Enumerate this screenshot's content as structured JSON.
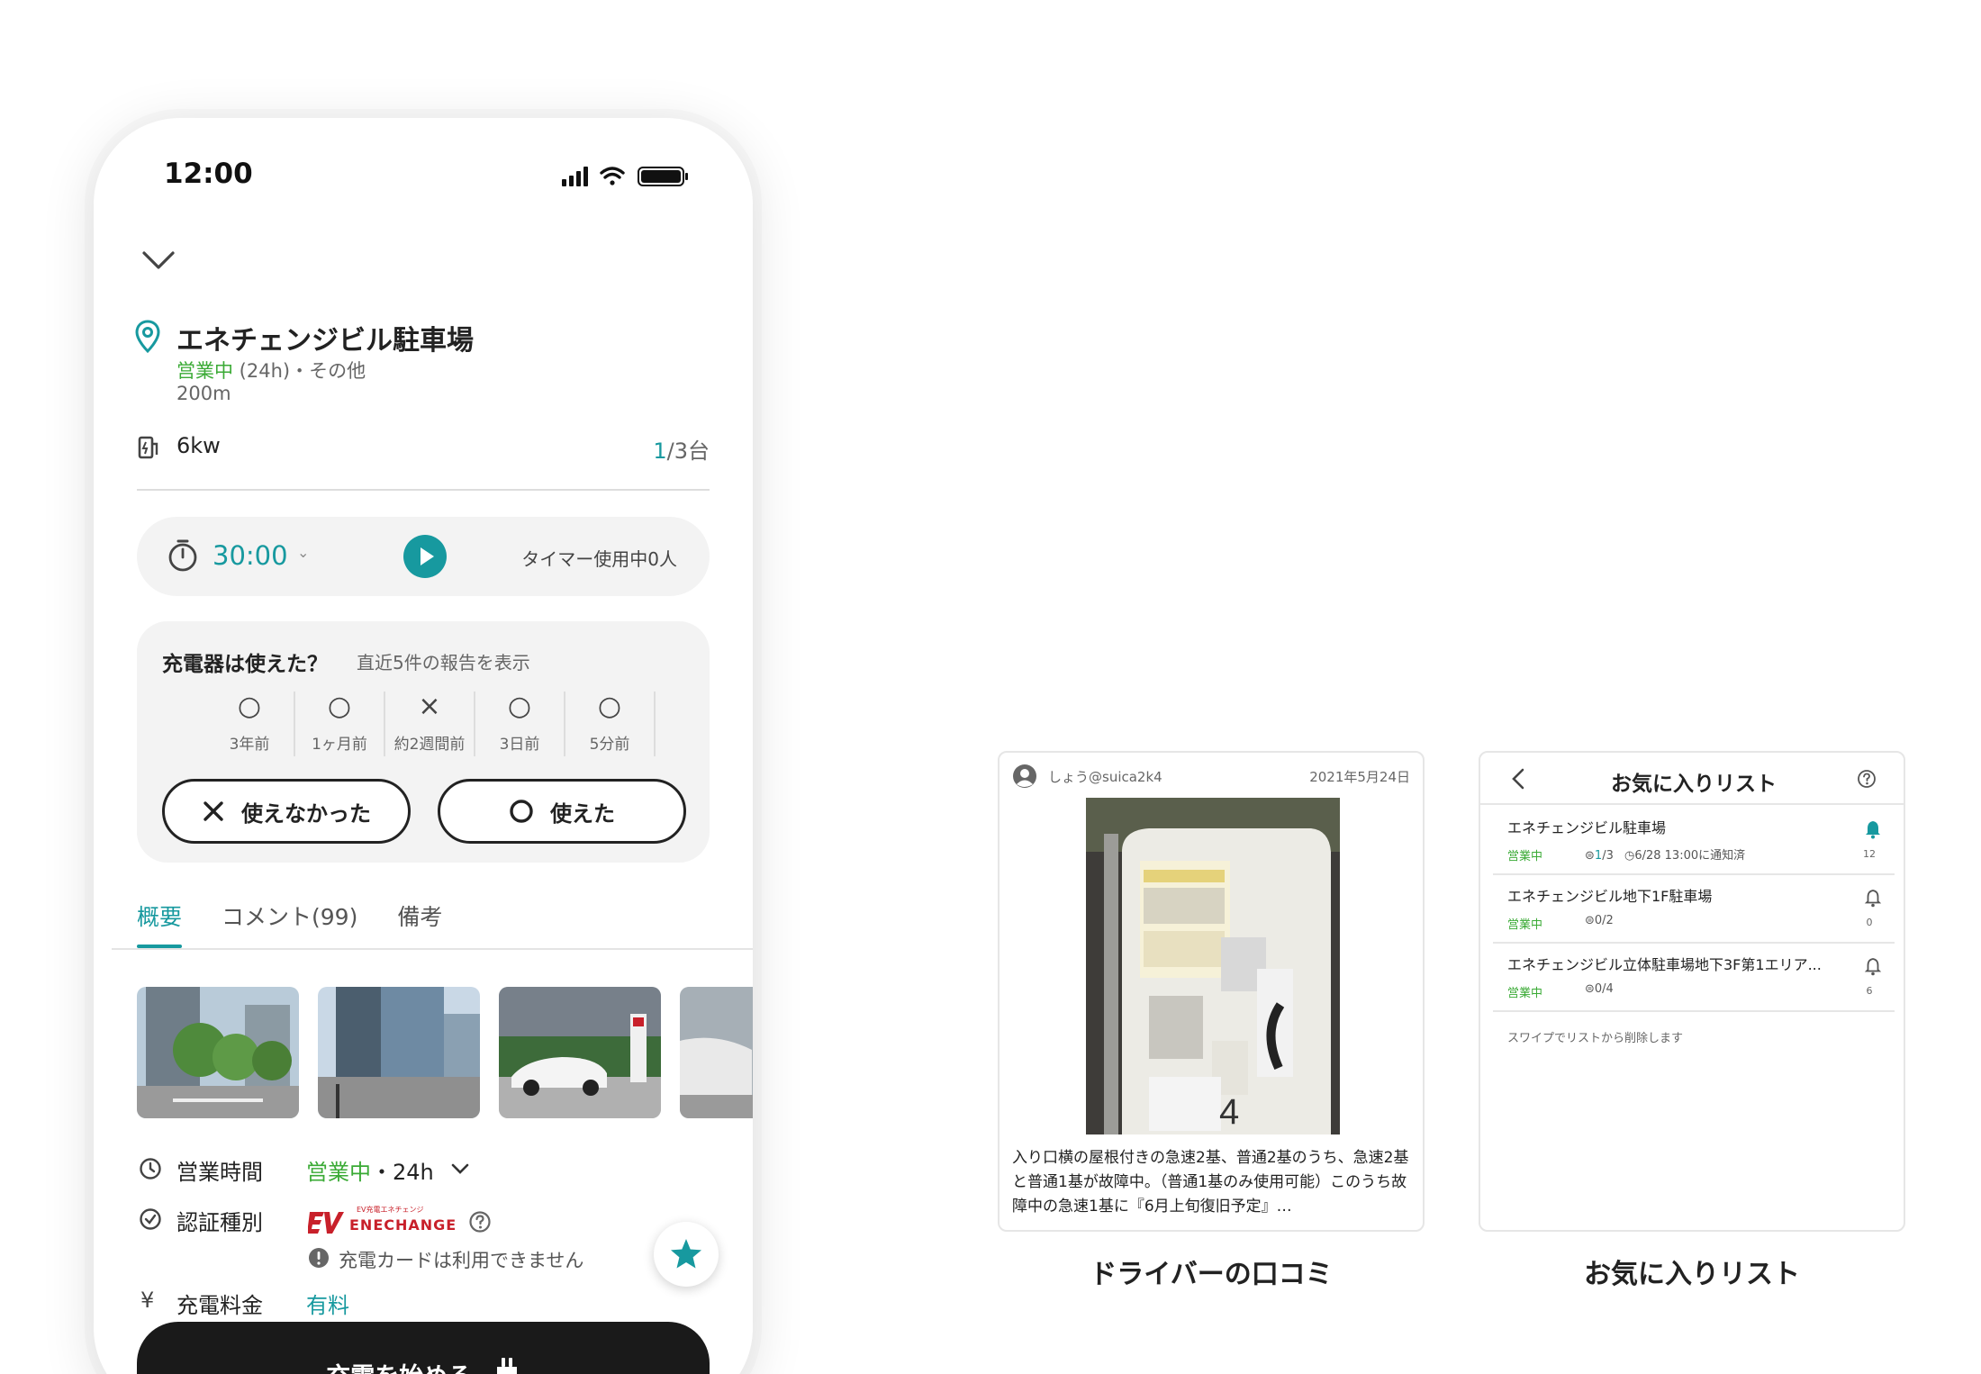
{
  "colors": {
    "accent": "#17999f",
    "open_green": "#3aaa35",
    "dark": "#1a1a1a"
  },
  "status_bar": {
    "time": "12:00",
    "icons": [
      "signal-icon",
      "wifi-icon",
      "battery-icon"
    ]
  },
  "place": {
    "name": "エネチェンジビル駐車場",
    "status_open": "営業中",
    "status_rest": " (24h)・その他",
    "distance": "200m",
    "power": "6kw",
    "avail_used": "1",
    "avail_total": "/3台"
  },
  "timer": {
    "value": "30:00",
    "caret": "⌄",
    "users_text": "タイマー使用中0人"
  },
  "report": {
    "title": "充電器は使えた？",
    "subtitle": "直近5件の報告を表示",
    "items": [
      {
        "mark": "○",
        "when": "3年前"
      },
      {
        "mark": "○",
        "when": "1ヶ月前"
      },
      {
        "mark": "×",
        "when": "約2週間前"
      },
      {
        "mark": "○",
        "when": "3日前"
      },
      {
        "mark": "○",
        "when": "5分前"
      }
    ],
    "btn_bad": "使えなかった",
    "btn_good": "使えた"
  },
  "tabs": [
    {
      "label": "概要"
    },
    {
      "label": "コメント(99)"
    },
    {
      "label": "備考"
    }
  ],
  "info": {
    "hours_label": "営業時間",
    "hours_open": "営業中",
    "hours_rest": "・24h",
    "auth_label": "認証種別",
    "auth_brand_small": "EV充電エネチェンジ",
    "auth_brand": "ENECHANGE",
    "auth_note": "充電カードは利用できません",
    "fee_label": "充電料金",
    "fee_value": "有料"
  },
  "cta": {
    "label": "充電を始める"
  },
  "review_card": {
    "user": "しょう@suica2k4",
    "date": "2021年5月24日",
    "text": "入り口横の屋根付きの急速2基、普通2基のうち、急速2基と普通1基が故障中。（普通1基のみ使用可能）このうち故障中の急速1基に『6月上旬復旧予定』…",
    "caption": "ドライバーの口コミ"
  },
  "favorites_card": {
    "title": "お気に入りリスト",
    "rows": [
      {
        "name": "エネチェンジビル駐車場",
        "status": "営業中",
        "avail": "1",
        "avail_rest": "/3",
        "notice": "6/28 13:00に通知済",
        "count": "12",
        "bell_active": true
      },
      {
        "name": "エネチェンジビル地下1F駐車場",
        "status": "営業中",
        "avail": "",
        "avail_rest": "0/2",
        "notice": "",
        "count": "0",
        "bell_active": false
      },
      {
        "name": "エネチェンジビル立体駐車場地下3F第1エリア...",
        "status": "営業中",
        "avail": "",
        "avail_rest": "0/4",
        "notice": "",
        "count": "6",
        "bell_active": false
      }
    ],
    "note": "スワイプでリストから削除します",
    "caption": "お気に入りリスト"
  }
}
